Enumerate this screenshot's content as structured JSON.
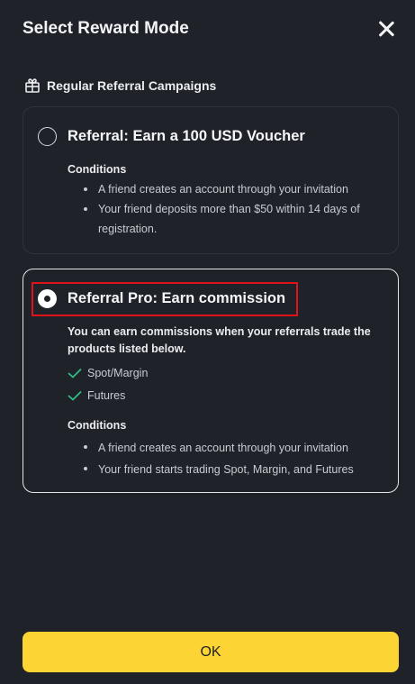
{
  "dialog": {
    "title": "Select Reward Mode"
  },
  "section": {
    "title": "Regular Referral Campaigns",
    "icon": "gift-icon"
  },
  "options": [
    {
      "title": "Referral: Earn a 100 USD Voucher",
      "selected": false,
      "conditions_heading": "Conditions",
      "conditions": [
        "A friend creates an account through your invitation",
        "Your friend deposits more than $50 within 14 days of registration."
      ]
    },
    {
      "title": "Referral Pro: Earn commission",
      "selected": true,
      "description": "You can earn commissions when your referrals trade the products listed below.",
      "products": [
        "Spot/Margin",
        "Futures"
      ],
      "conditions_heading": "Conditions",
      "conditions": [
        "A friend creates an account through your invitation",
        "Your friend starts trading Spot, Margin, and Futures"
      ]
    }
  ],
  "ok_label": "OK",
  "colors": {
    "background": "#1f2229",
    "accent": "#fcd535",
    "check": "#2ebd85",
    "highlight": "#e0121a"
  }
}
